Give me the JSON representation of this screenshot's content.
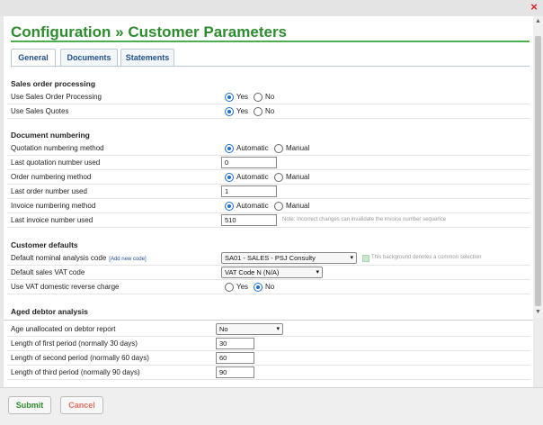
{
  "title": "Configuration » Customer Parameters",
  "tabs": {
    "general": "General",
    "documents": "Documents",
    "statements": "Statements"
  },
  "sections": {
    "sales_order": "Sales order processing",
    "doc_numbering": "Document numbering",
    "customer_defaults": "Customer defaults",
    "aged_debtor": "Aged debtor analysis"
  },
  "rows": {
    "use_sop": "Use Sales Order Processing",
    "use_quotes": "Use Sales Quotes",
    "quote_method": "Quotation numbering method",
    "last_quote": "Last quotation number used",
    "order_method": "Order numbering method",
    "last_order": "Last order number used",
    "invoice_method": "Invoice numbering method",
    "last_invoice": "Last invoice number used",
    "nominal_code": "Default nominal analysis code",
    "add_new_code": "[Add new code]",
    "vat_code": "Default sales VAT code",
    "vat_reverse": "Use VAT domestic reverse charge",
    "age_unallocated": "Age unallocated on debtor report",
    "first_period": "Length of first period (normally 30 days)",
    "second_period": "Length of second period (normally 60 days)",
    "third_period": "Length of third period (normally 90 days)"
  },
  "options": {
    "yes": "Yes",
    "no": "No",
    "automatic": "Automatic",
    "manual": "Manual"
  },
  "values": {
    "last_quote": "0",
    "last_order": "1",
    "last_invoice": "510",
    "nominal_code": "SA01 - SALES - PSJ Consulty",
    "vat_code": "VAT Code N (N/A)",
    "age_unallocated": "No",
    "first_period": "30",
    "second_period": "60",
    "third_period": "90"
  },
  "notes": {
    "invoice": "Note: Incorrect changes can invalidate the invoice number sequence",
    "background": "This background denotes a common selection"
  },
  "buttons": {
    "submit": "Submit",
    "cancel": "Cancel"
  },
  "colors": {
    "title_green": "#2e8b2e",
    "radio_blue": "#1f6fd1",
    "cancel_red": "#e07060"
  }
}
